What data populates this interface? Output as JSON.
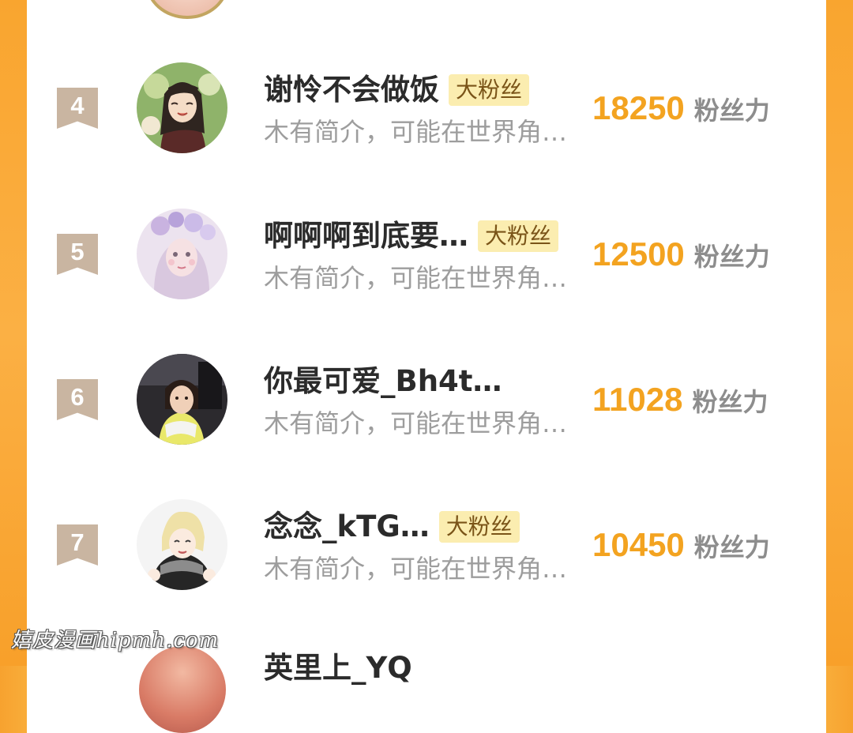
{
  "theme": {
    "accent": "#f3a320",
    "frame": "#f9ad3a",
    "badge_bg": "#fbedb0",
    "rank_ribbon": "#c9b5a1"
  },
  "rows": [
    {
      "rank": "4",
      "name": "谢怜不会做饭",
      "badge": "大粉丝",
      "bio": "木有简介，可能在世界角…",
      "score": "18250",
      "unit": "粉丝力",
      "avatar_icon": "avatar-anime-boy-long-hair"
    },
    {
      "rank": "5",
      "name": "啊啊啊到底要…",
      "badge": "大粉丝",
      "bio": "木有简介，可能在世界角…",
      "score": "12500",
      "unit": "粉丝力",
      "avatar_icon": "avatar-girl-flower-crown"
    },
    {
      "rank": "6",
      "name": "你最可爱_Bh4t…",
      "badge": "",
      "bio": "木有简介，可能在世界角…",
      "score": "11028",
      "unit": "粉丝力",
      "avatar_icon": "avatar-photo-person-in-car"
    },
    {
      "rank": "7",
      "name": "念念_kTG…",
      "badge": "大粉丝",
      "bio": "木有简介，可能在世界角…",
      "score": "10450",
      "unit": "粉丝力",
      "avatar_icon": "avatar-anime-blond-boy"
    }
  ],
  "partial_next_row": {
    "name": "英里上_YQ"
  },
  "watermark": "嬉皮漫画hipmh.com"
}
